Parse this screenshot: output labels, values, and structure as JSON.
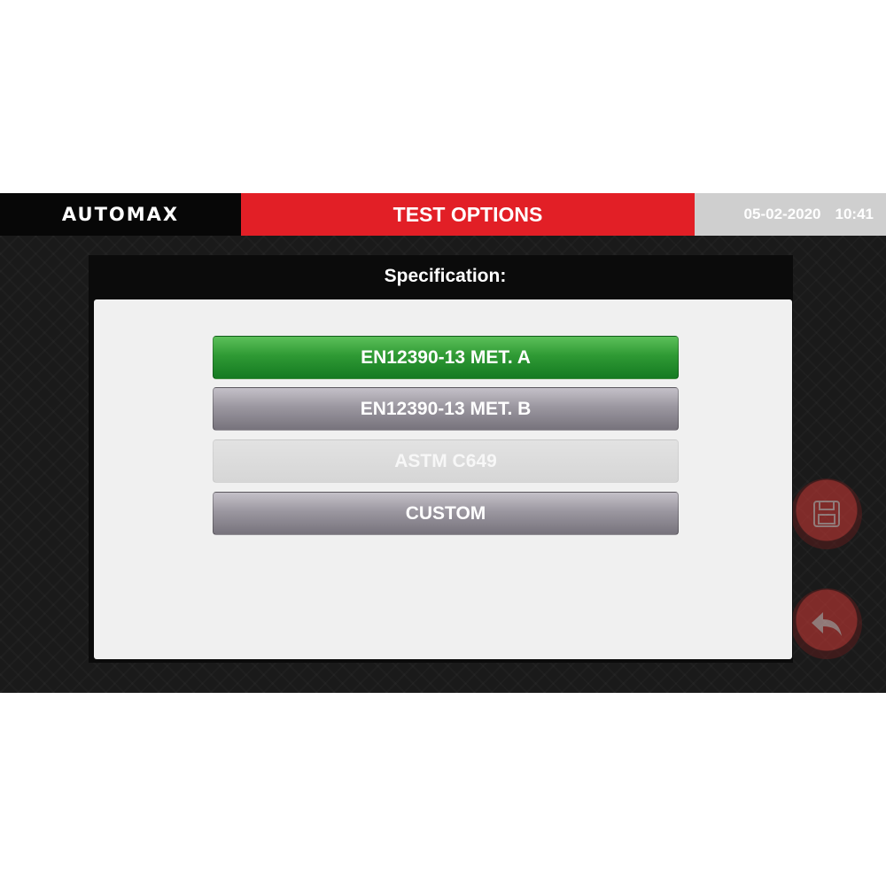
{
  "header": {
    "brand": "AUTOMAX",
    "title": "TEST OPTIONS",
    "date": "05-02-2020",
    "time": "10:41"
  },
  "dialog": {
    "title": "Specification:",
    "options": [
      {
        "label": "EN12390-13 MET. A",
        "state": "selected"
      },
      {
        "label": "EN12390-13 MET. B",
        "state": "normal"
      },
      {
        "label": "ASTM C649",
        "state": "disabled"
      },
      {
        "label": "CUSTOM",
        "state": "normal"
      }
    ]
  },
  "side_buttons": {
    "save_icon": "floppy-disk-icon",
    "back_icon": "back-arrow-icon"
  },
  "colors": {
    "title_bar": "#e21f26",
    "selected": "#2f9a34",
    "option": "#9b97a0",
    "datetime_bg": "#cfcfcf"
  }
}
